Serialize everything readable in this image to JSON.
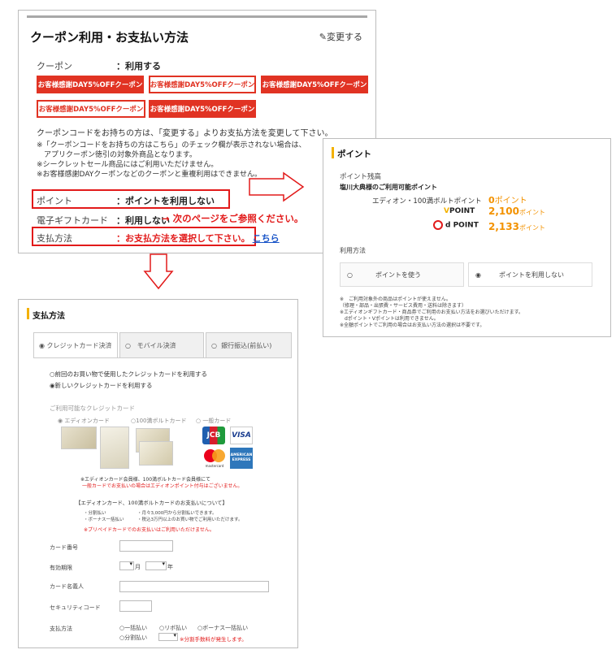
{
  "panel1": {
    "title": "クーポン利用・お支払い方法",
    "edit_label": "変更する",
    "coupon_label": "クーポン",
    "coupon_value": "：利用する",
    "coupon_buttons": [
      "お客様感謝DAY5%OFFクーポン",
      "お客様感謝DAY5%OFFクーポン",
      "お客様感謝DAY5%OFFクーポン",
      "お客様感謝DAY5%OFFクーポン",
      "お客様感謝DAY5%OFFクーポン"
    ],
    "notes": [
      "クーポンコードをお持ちの方は、「変更する」よりお支払方法を変更して下さい。",
      "※「クーポンコードをお持ちの方はこちら」のチェック欄が表示されない場合は、",
      "　アプリクーポン徳引の対象外商品となります。",
      "※シークレットセール商品にはご利用いただけません。",
      "※お客様感謝DAYクーポンなどのクーポンと重複利用はできません。"
    ],
    "point_label": "ポイント",
    "point_value": "：ポイントを利用しない",
    "gift_label": "電子ギフトカード",
    "gift_value": "：利用しない",
    "gift_annotation": "→ 次のページをご参照ください。",
    "pay_label": "支払方法",
    "pay_value": "：お支払方法を選択して下さい。",
    "pay_link": "こちら"
  },
  "panel2": {
    "title": "ポイント",
    "balance_label": "ポイント残高",
    "member_label": "塩川大典様のご利用可能ポイント",
    "edion_label": "エディオン・100満ボルトポイント",
    "edion_value": "0",
    "v_label": "POINT",
    "v_value": "2,100",
    "d_label": "d POINT",
    "d_value": "2,133",
    "unit": "ポイント",
    "usage_label": "利用方法",
    "option_use": "ポイントを使う",
    "option_nouse": "ポイントを利用しない",
    "notes": [
      "※　ご利用対象外の商品はポイントが使えません。",
      "（修理・部品・出張費・サービス費用・送料は除きます）",
      "※エディオンギフトカード・商品券でご利用のお支払い方法をお選びいただけます。",
      "　dポイント・Vポイントは利用できません。",
      "※全額ポイントでご利用の場合はお支払い方法の選択は不要です。"
    ]
  },
  "panel3": {
    "title": "支払方法",
    "tabs": [
      "クレジットカード決済",
      "モバイル決済",
      "銀行振込(前払い)"
    ],
    "opt_prev": "前回のお買い物で使用したクレジットカードを利用する",
    "opt_new": "新しいクレジットカードを利用する",
    "available_cards": "ご利用可能なクレジットカード",
    "card_types": [
      "エディオンカード",
      "100満ボルトカード",
      "一般カード"
    ],
    "brand_jcb": "JCB",
    "brand_visa": "VISA",
    "brand_mc": "mastercard",
    "brand_amex": "AMERICAN EXPRESS",
    "card_note1": "※エディオンカード会員様、100満ボルトカード会員様にて",
    "card_note2": "一般カードでお支払いの場合はエディオンポイント付与はございません。",
    "bracket": "【エディオンカード、100満ボルトカードのお支払いについて】",
    "pay_note1a": "・分割払い",
    "pay_note1b": "・月々3,000円から分割払いできます。",
    "pay_note2a": "・ボーナス一括払い",
    "pay_note2b": "・税込3万円以上のお買い物でご利用いただけます。",
    "prepaid_note": "※プリペイドカードでのお支払いはご利用いただけません。",
    "field_card_no": "カード番号",
    "field_expiry": "有効期限",
    "month": "月",
    "year": "年",
    "field_holder": "カード名義人",
    "field_cvc": "セキュリティコード",
    "field_method": "支払方法",
    "method_options": [
      "一括払い",
      "リボ払い",
      "ボーナス一括払い"
    ],
    "method_split": "分割払い",
    "split_fee_note": "※分割手数料が発生します。"
  }
}
